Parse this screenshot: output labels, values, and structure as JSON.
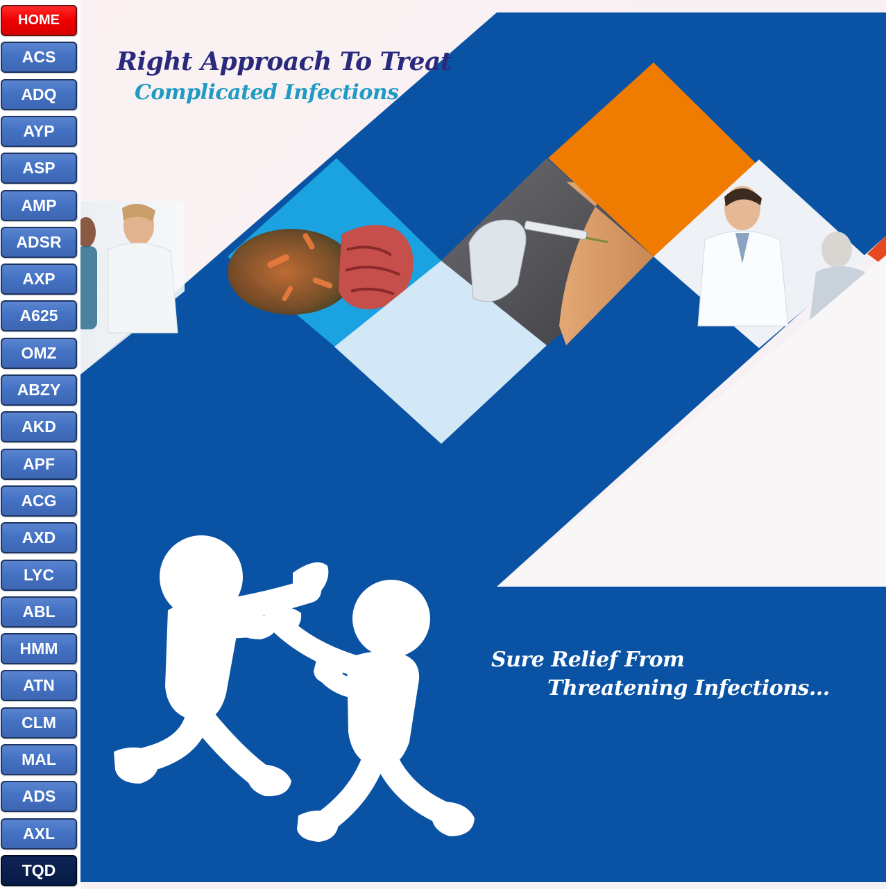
{
  "sidebar": {
    "items": [
      {
        "label": "HOME",
        "variant": "home"
      },
      {
        "label": "ACS"
      },
      {
        "label": "ADQ"
      },
      {
        "label": "AYP"
      },
      {
        "label": "ASP"
      },
      {
        "label": "AMP"
      },
      {
        "label": "ADSR"
      },
      {
        "label": "AXP"
      },
      {
        "label": "A625"
      },
      {
        "label": "OMZ"
      },
      {
        "label": "ABZY"
      },
      {
        "label": "AKD"
      },
      {
        "label": "APF"
      },
      {
        "label": "ACG"
      },
      {
        "label": "AXD"
      },
      {
        "label": "LYC"
      },
      {
        "label": "ABL"
      },
      {
        "label": "HMM"
      },
      {
        "label": "ATN"
      },
      {
        "label": "CLM"
      },
      {
        "label": "MAL"
      },
      {
        "label": "ADS"
      },
      {
        "label": "AXL"
      },
      {
        "label": "TQD",
        "variant": "dark"
      }
    ]
  },
  "banner": {
    "title_line1": "Right Approach To Treat",
    "title_line2": "Complicated Infections",
    "tagline_line1": "Sure Relief From",
    "tagline_line2": "Threatening Infections..."
  },
  "colors": {
    "brand_blue": "#0a52a3",
    "orange": "#ef7b00",
    "light_blue": "#d2e8f7",
    "sky_blue": "#1aa3e0",
    "home_red": "#ee0000",
    "nav_blue": "#4472c4",
    "nav_dark": "#0a1e4d"
  },
  "icons": {
    "illustration": "stick-figures-fighting-icon"
  }
}
